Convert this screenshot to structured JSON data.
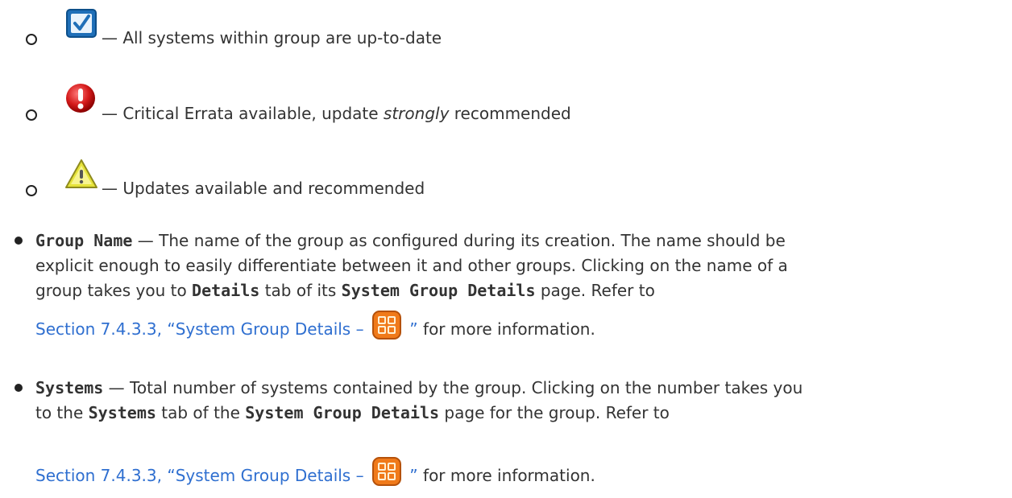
{
  "status_list": [
    {
      "icon": "checked-box-icon",
      "text": "— All systems within group are up-to-date"
    },
    {
      "icon": "critical-errata-icon",
      "text_before": "— Critical Errata available, update ",
      "text_em": "strongly",
      "text_after": " recommended"
    },
    {
      "icon": "warning-triangle-icon",
      "text": "— Updates available and recommended"
    }
  ],
  "group_name": {
    "term": "Group Name",
    "line1": " — The name of the group as configured during its creation. The name should be",
    "line2": "explicit enough to easily differentiate between it and other groups. Clicking on the name of a",
    "line3_a": "group takes you to ",
    "line3_b": "Details",
    "line3_c": " tab of its ",
    "line3_d": "System Group Details",
    "line3_e": " page. Refer to",
    "link_text_a": "Section 7.4.3.3, “System Group Details – ",
    "link_text_b": " ”",
    "after_link": " for more information."
  },
  "systems": {
    "term": "Systems",
    "line1": " — Total number of systems contained by the group. Clicking on the number takes you",
    "line2_a": "to the ",
    "line2_b": "Systems",
    "line2_c": " tab of the ",
    "line2_d": "System Group Details",
    "line2_e": " page for the group. Refer to",
    "link_text_a": "Section 7.4.3.3, “System Group Details – ",
    "link_text_b": " ”",
    "after_link": " for more information."
  },
  "colors": {
    "text": "#333333",
    "link": "#2f6fd0",
    "group_icon": "#f07a1a"
  }
}
